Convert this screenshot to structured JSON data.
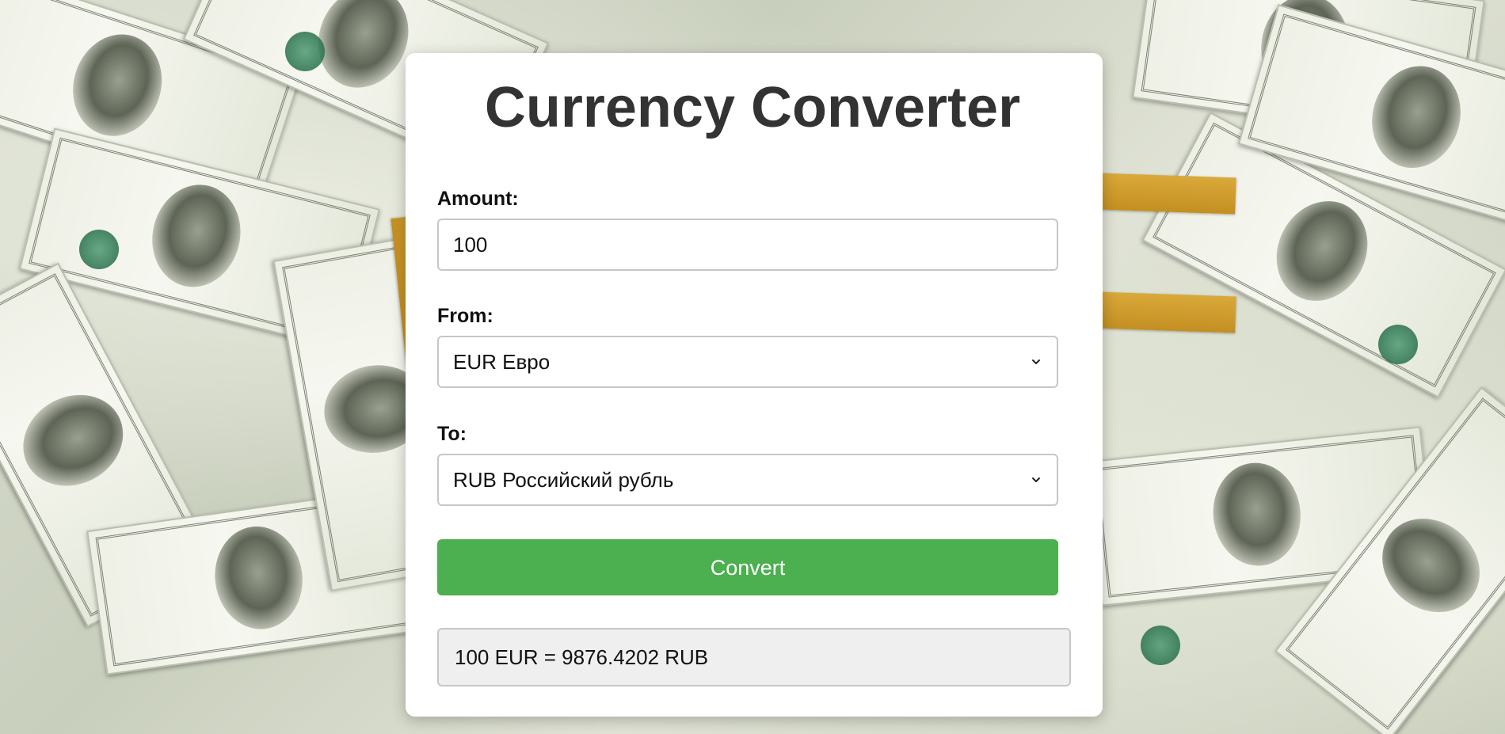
{
  "app": {
    "title": "Currency Converter"
  },
  "form": {
    "amount_label": "Amount:",
    "amount_value": "100",
    "from_label": "From:",
    "from_selected": "EUR Евро",
    "to_label": "To:",
    "to_selected": "RUB Российский рубль",
    "convert_label": "Convert"
  },
  "result": {
    "text": "100 EUR = 9876.4202 RUB"
  },
  "icons": {
    "dropdown": "chevron-down-icon"
  },
  "colors": {
    "accent": "#4caf50",
    "title": "#333333",
    "result_bg": "#efefef",
    "card_bg": "#ffffff"
  }
}
